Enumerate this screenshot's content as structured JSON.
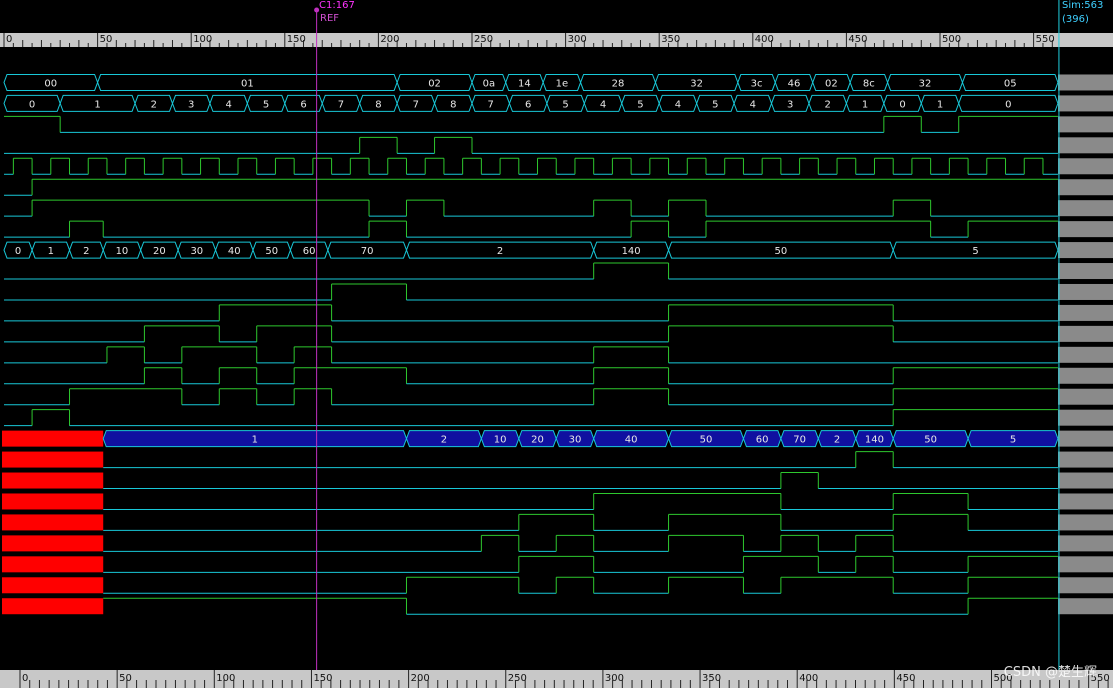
{
  "cursor": {
    "label": "C1:167",
    "ref": "REF",
    "time": 167
  },
  "sim": {
    "label": "Sim:563",
    "sub": "(396)"
  },
  "watermark": "CSDN @楚生辉",
  "timeline": {
    "start": 0,
    "end": 563,
    "major_step": 50,
    "minor_step": 5
  },
  "bottom_ruler": {
    "start": 0,
    "end": 563,
    "major_step": 50
  },
  "colors": {
    "background": "#000000",
    "bus": "#18c8d8",
    "signal_high": "#2ec82e",
    "signal_low": "#18c8d8",
    "cursor": "#c030c0",
    "right_edge": "#20d0e0",
    "ruler": "#c8c8c8",
    "status_column": "#8a8a8a",
    "undefined": "#ff0000",
    "bus_fill_blue": "#1010a0"
  },
  "rows": [
    {
      "type": "bus",
      "segments": [
        [
          0,
          50,
          "00"
        ],
        [
          50,
          210,
          "01"
        ],
        [
          210,
          250,
          "02"
        ],
        [
          250,
          268,
          "0a"
        ],
        [
          268,
          288,
          "14"
        ],
        [
          288,
          308,
          "1e"
        ],
        [
          308,
          348,
          "28"
        ],
        [
          348,
          392,
          "32"
        ],
        [
          392,
          412,
          "3c"
        ],
        [
          412,
          432,
          "46"
        ],
        [
          432,
          452,
          "02"
        ],
        [
          452,
          472,
          "8c"
        ],
        [
          472,
          512,
          "32"
        ],
        [
          512,
          563,
          "05"
        ]
      ]
    },
    {
      "type": "bus",
      "segments": [
        [
          0,
          30,
          "0"
        ],
        [
          30,
          70,
          "1"
        ],
        [
          70,
          90,
          "2"
        ],
        [
          90,
          110,
          "3"
        ],
        [
          110,
          130,
          "4"
        ],
        [
          130,
          150,
          "5"
        ],
        [
          150,
          170,
          "6"
        ],
        [
          170,
          190,
          "7"
        ],
        [
          190,
          210,
          "8"
        ],
        [
          210,
          230,
          "7"
        ],
        [
          230,
          250,
          "8"
        ],
        [
          250,
          270,
          "7"
        ],
        [
          270,
          290,
          "6"
        ],
        [
          290,
          310,
          "5"
        ],
        [
          310,
          330,
          "4"
        ],
        [
          330,
          350,
          "5"
        ],
        [
          350,
          370,
          "4"
        ],
        [
          370,
          390,
          "5"
        ],
        [
          390,
          410,
          "4"
        ],
        [
          410,
          430,
          "3"
        ],
        [
          430,
          450,
          "2"
        ],
        [
          450,
          470,
          "1"
        ],
        [
          470,
          490,
          "0"
        ],
        [
          490,
          510,
          "1"
        ],
        [
          510,
          563,
          "0"
        ]
      ]
    },
    {
      "type": "bit",
      "init": 1,
      "edges": [
        30,
        470,
        490,
        510
      ]
    },
    {
      "type": "bit",
      "init": 0,
      "edges": [
        190,
        210,
        230,
        250
      ]
    },
    {
      "type": "bit",
      "init": 0,
      "edges": [
        5,
        15,
        25,
        35,
        45,
        55,
        65,
        75,
        85,
        95,
        105,
        115,
        125,
        135,
        145,
        155,
        165,
        175,
        185,
        195,
        205,
        215,
        225,
        235,
        245,
        255,
        265,
        275,
        285,
        295,
        305,
        315,
        325,
        335,
        345,
        355,
        365,
        375,
        385,
        395,
        405,
        415,
        425,
        435,
        445,
        455,
        465,
        475,
        485,
        495,
        505,
        515,
        525,
        535,
        545,
        555,
        563
      ]
    },
    {
      "type": "bit",
      "init": 0,
      "edges": [
        15
      ]
    },
    {
      "type": "bit",
      "init": 0,
      "edges": [
        15,
        195,
        215,
        235,
        315,
        335,
        355,
        375,
        475,
        495
      ]
    },
    {
      "type": "bit",
      "init": 0,
      "edges": [
        35,
        53,
        195,
        215,
        335,
        355,
        375,
        495,
        515
      ]
    },
    {
      "type": "bus",
      "segments": [
        [
          0,
          15,
          "0"
        ],
        [
          15,
          35,
          "1"
        ],
        [
          35,
          53,
          "2"
        ],
        [
          53,
          73,
          "10"
        ],
        [
          73,
          93,
          "20"
        ],
        [
          93,
          113,
          "30"
        ],
        [
          113,
          133,
          "40"
        ],
        [
          133,
          153,
          "50"
        ],
        [
          153,
          173,
          "60"
        ],
        [
          173,
          215,
          "70"
        ],
        [
          215,
          315,
          "2"
        ],
        [
          315,
          355,
          "140"
        ],
        [
          355,
          475,
          "50"
        ],
        [
          475,
          563,
          "5"
        ]
      ]
    },
    {
      "type": "bit",
      "init": 0,
      "edges": [
        315,
        355
      ]
    },
    {
      "type": "bit",
      "init": 0,
      "edges": [
        175,
        215
      ]
    },
    {
      "type": "bit",
      "init": 0,
      "edges": [
        115,
        175,
        355,
        475
      ]
    },
    {
      "type": "bit",
      "init": 0,
      "edges": [
        75,
        115,
        135,
        175,
        355,
        475
      ]
    },
    {
      "type": "bit",
      "init": 0,
      "edges": [
        55,
        75,
        95,
        135,
        155,
        175,
        315,
        355
      ]
    },
    {
      "type": "bit",
      "init": 0,
      "edges": [
        75,
        95,
        115,
        135,
        155,
        215,
        315,
        355,
        475
      ]
    },
    {
      "type": "bit",
      "init": 0,
      "edges": [
        35,
        95,
        115,
        135,
        155,
        175,
        315,
        355,
        475
      ]
    },
    {
      "type": "bit",
      "init": 0,
      "edges": [
        15,
        35,
        475
      ]
    },
    {
      "type": "bus",
      "undefined_until": 53,
      "filled": true,
      "segments": [
        [
          53,
          215,
          "1"
        ],
        [
          215,
          255,
          "2"
        ],
        [
          255,
          275,
          "10"
        ],
        [
          275,
          295,
          "20"
        ],
        [
          295,
          315,
          "30"
        ],
        [
          315,
          355,
          "40"
        ],
        [
          355,
          395,
          "50"
        ],
        [
          395,
          415,
          "60"
        ],
        [
          415,
          435,
          "70"
        ],
        [
          435,
          455,
          "2"
        ],
        [
          455,
          475,
          "140"
        ],
        [
          475,
          515,
          "50"
        ],
        [
          515,
          563,
          "5"
        ]
      ]
    },
    {
      "type": "bit",
      "undefined_until": 53,
      "init": 0,
      "edges": [
        455,
        475
      ]
    },
    {
      "type": "bit",
      "undefined_until": 53,
      "init": 0,
      "edges": [
        415,
        435
      ]
    },
    {
      "type": "bit",
      "undefined_until": 53,
      "init": 0,
      "edges": [
        315,
        415,
        475,
        515
      ]
    },
    {
      "type": "bit",
      "undefined_until": 53,
      "init": 0,
      "edges": [
        275,
        315,
        355,
        415,
        475,
        515
      ]
    },
    {
      "type": "bit",
      "undefined_until": 53,
      "init": 0,
      "edges": [
        255,
        275,
        295,
        315,
        355,
        395,
        415,
        435,
        455,
        475
      ]
    },
    {
      "type": "bit",
      "undefined_until": 53,
      "init": 0,
      "edges": [
        275,
        315,
        395,
        435,
        455,
        475,
        515
      ]
    },
    {
      "type": "bit",
      "undefined_until": 53,
      "init": 0,
      "edges": [
        215,
        275,
        295,
        315,
        355,
        395,
        415,
        475,
        515
      ]
    },
    {
      "type": "bit",
      "undefined_until": 53,
      "init": 1,
      "edges": [
        215,
        515
      ]
    }
  ]
}
